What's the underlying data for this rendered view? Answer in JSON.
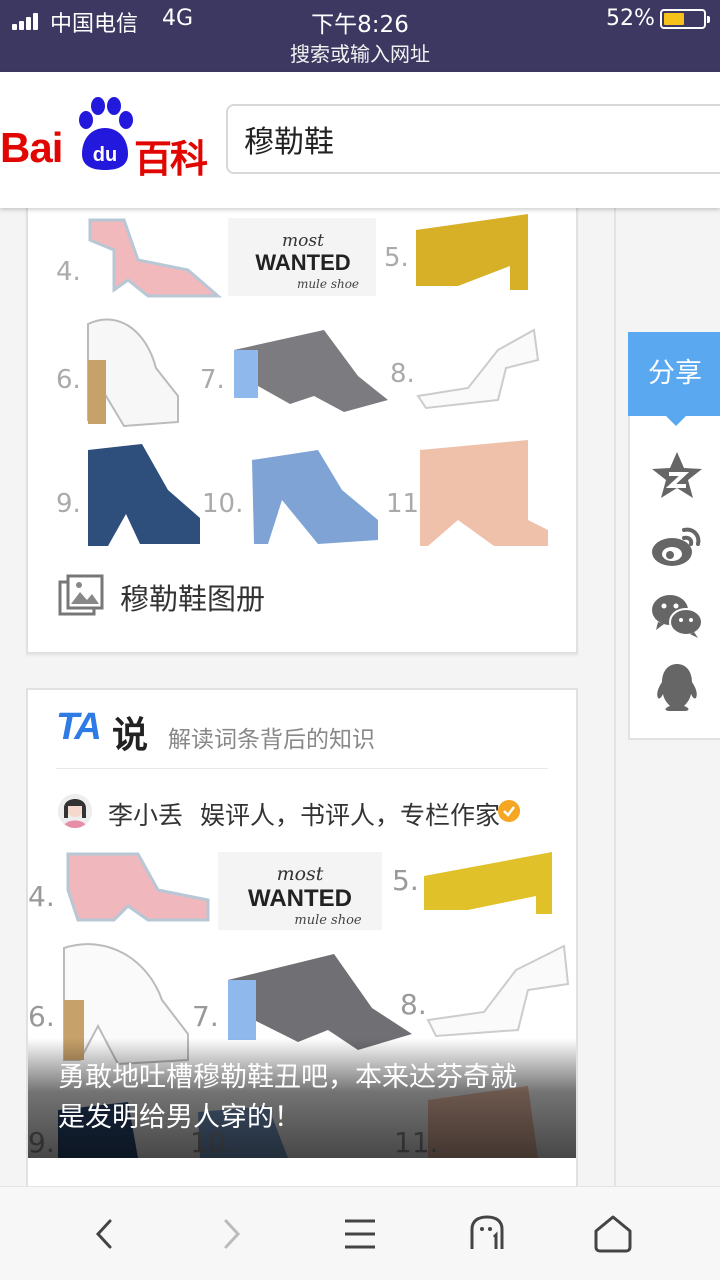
{
  "status_bar": {
    "carrier": "中国电信",
    "network": "4G",
    "time": "下午8:26",
    "url_hint": "搜索或输入网址",
    "battery_percent": "52%",
    "battery_level": 0.52
  },
  "header": {
    "logo_text_left": "Bai",
    "logo_text_paw": "du",
    "logo_text_right": "百科",
    "search_value": "穆勒鞋"
  },
  "gallery_card": {
    "collage_labels": [
      "4.",
      "5.",
      "6.",
      "7.",
      "8.",
      "9.",
      "10.",
      "11."
    ],
    "most_wanted_line1": "most",
    "most_wanted_line2": "WANTED",
    "most_wanted_line3": "mule shoe",
    "gallery_label": "穆勒鞋图册"
  },
  "ta_card": {
    "logo_ta": "TA",
    "logo_shuo": "说",
    "subtitle": "解读词条背后的知识",
    "author_name": "李小丢",
    "author_title": "娱评人，书评人，专栏作家",
    "caption_line1": "勇敢地吐槽穆勒鞋丑吧，本来达芬奇就",
    "caption_line2": "是发明给男人穿的！"
  },
  "share_panel": {
    "share_label": "分享",
    "icons": [
      "qzone-icon",
      "weibo-icon",
      "wechat-icon",
      "qq-icon"
    ]
  },
  "bottom_bar": {
    "buttons": [
      "back-icon",
      "forward-icon",
      "menu-icon",
      "tabs-icon",
      "home-icon"
    ]
  },
  "colors": {
    "status_bar_bg": "#3c3862",
    "baidu_red": "#e10602",
    "baidu_blue": "#2319dc",
    "share_blue": "#5aa9f0",
    "ta_blue": "#2e7be6"
  }
}
